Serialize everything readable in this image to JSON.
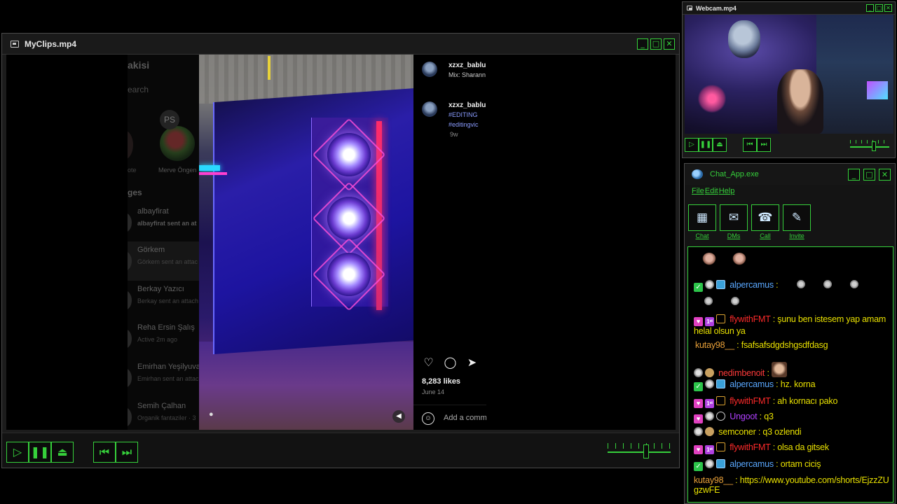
{
  "player": {
    "title": "MyClips.mp4",
    "buttons": {
      "minimize": "_",
      "maximize": "□",
      "close": "✕"
    },
    "instagram": {
      "account": "akisi",
      "search_placeholder": "earch",
      "note_left": "ote",
      "story_ps": "PS",
      "story_name": "Merve Öngen",
      "messages_heading": "ges",
      "dms": [
        {
          "name": "albayfirat",
          "sub": "albayfirat sent an at",
          "bold": true
        },
        {
          "name": "Görkem",
          "sub": "Görkem sent an attac",
          "bold": false
        },
        {
          "name": "Berkay Yazıcı",
          "sub": "Berkay sent an attach",
          "bold": false
        },
        {
          "name": "Reha Ersin Şalış",
          "sub": "Active 2m ago",
          "bold": false
        },
        {
          "name": "Emirhan Yeşilyuva",
          "sub": "Emirhan sent an attac",
          "bold": false
        },
        {
          "name": "Semih Çalhan",
          "sub": "Organik fantaziler · 3",
          "bold": false
        }
      ],
      "post": {
        "author": "xzxz_bablu",
        "music": "Mix: Sharann",
        "comment_user": "xzxz_bablu",
        "comment_tag1": "#EDITING",
        "comment_tag2": "#editingvic",
        "comment_time": "9w",
        "likes": "8,283 likes",
        "date": "June 14",
        "add_comment": "Add a comm"
      }
    },
    "controls": {
      "play": "▷",
      "pause": "❚❚",
      "eject": "⏏",
      "prev": "⏮",
      "next": "⏭",
      "volume_pct": 62
    }
  },
  "webcam": {
    "title": "Webcam.mp4",
    "controls": {
      "play": "▷",
      "pause": "❚❚",
      "eject": "⏏",
      "prev": "⏮",
      "next": "⏭",
      "volume_pct": 62
    }
  },
  "chat": {
    "title": "Chat_App.exe",
    "menu": [
      "File",
      "Edit",
      "Help"
    ],
    "toolbar": [
      {
        "label": "Chat",
        "icon": "▦"
      },
      {
        "label": "DMs",
        "icon": "✉"
      },
      {
        "label": "Call",
        "icon": "☎"
      },
      {
        "label": "Invite",
        "icon": "✎"
      }
    ],
    "messages": [
      {
        "user": "alpercamus",
        "sep": " :",
        "text": "",
        "user_color": "#5aa8ff",
        "text_color": "#e8e000"
      },
      {
        "user": "flywithFMT",
        "sep": " :",
        "text": " şunu ben istesem yap amam helal olsun ya",
        "user_color": "#ff2a2a",
        "text_color": "#e8e000"
      },
      {
        "user": "kutay98__",
        "sep": " :",
        "text": " fsafsafsdgdshgsdfdasg",
        "user_color": "#e8a038",
        "text_color": "#e8e000"
      },
      {
        "user": "nedimbenoit",
        "sep": " :",
        "text": "",
        "user_color": "#ff3a3a",
        "text_color": "#e8e000"
      },
      {
        "user": "alpercamus",
        "sep": " :",
        "text": " hz. korna",
        "user_color": "#5aa8ff",
        "text_color": "#e8e000"
      },
      {
        "user": "flywithFMT",
        "sep": " :",
        "text": " ah kornacı pako",
        "user_color": "#ff2a2a",
        "text_color": "#e8e000"
      },
      {
        "user": "Ungoot",
        "sep": " :",
        "text": " q3",
        "user_color": "#b040ff",
        "text_color": "#e8e000"
      },
      {
        "user": "semconer",
        "sep": " :",
        "text": " q3 ozlendi",
        "user_color": "#e8e000",
        "text_color": "#e8e000"
      },
      {
        "user": "flywithFMT",
        "sep": " :",
        "text": " olsa da gitsek",
        "user_color": "#ff2a2a",
        "text_color": "#e8e000"
      },
      {
        "user": "alpercamus",
        "sep": " :",
        "text": " ortam ciciş",
        "user_color": "#5aa8ff",
        "text_color": "#e8e000"
      },
      {
        "user": "kutay98__",
        "sep": " :",
        "text": " https://www.youtube.com/shorts/EjzzZUgzwFE",
        "user_color": "#e8a038",
        "text_color": "#e8e000"
      }
    ]
  }
}
